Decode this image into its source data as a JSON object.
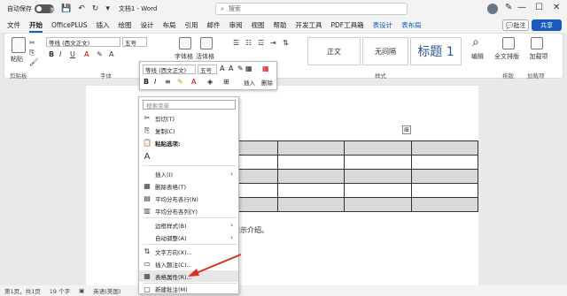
{
  "titlebar": {
    "autosave_label": "自动保存",
    "autosave_state": "关",
    "doc_title": "文档1 - Word",
    "search_placeholder": "搜索",
    "minimize": "—",
    "maximize": "☐",
    "close": "✕"
  },
  "menu": {
    "tabs": [
      "文件",
      "开始",
      "OfficePLUS",
      "插入",
      "绘图",
      "设计",
      "布局",
      "引用",
      "邮件",
      "审阅",
      "视图",
      "帮助",
      "开发工具",
      "PDF工具箱",
      "表设计",
      "表布局"
    ],
    "active_tab": "开始",
    "comment_label": "批注",
    "share_label": "共享"
  },
  "ribbon": {
    "paste_label": "粘贴",
    "clipboard_label": "剪贴板",
    "font_name": "等线 (西文正文)",
    "font_size": "五号",
    "font_group_label": "字体",
    "char_form_label": "字体格",
    "paste_style_label": "活体格",
    "styles": [
      "正文",
      "无间隔",
      "标题 1"
    ],
    "styles_group_label": "样式",
    "editing_label": "编辑",
    "fullscreen_label": "全文排版",
    "layout_group_label": "排版",
    "addin_label": "加载项",
    "addin_group_label": "加载项"
  },
  "mini_toolbar": {
    "font_name": "等线 (西文正文)",
    "font_size": "五号",
    "insert_label": "插入",
    "delete_label": "删除"
  },
  "context_menu": {
    "search_placeholder": "搜索菜单",
    "items": [
      {
        "icon": "✂",
        "label": "剪切(T)"
      },
      {
        "icon": "⎘",
        "label": "复制(C)"
      },
      {
        "icon": "📋",
        "label": "粘贴选项:"
      },
      {
        "icon": "A",
        "label": ""
      },
      {
        "icon": "",
        "label": "插入(I)",
        "submenu": true
      },
      {
        "icon": "▦",
        "label": "删除表格(T)"
      },
      {
        "icon": "▤",
        "label": "平均分布各行(N)"
      },
      {
        "icon": "▥",
        "label": "平均分布各列(Y)"
      },
      {
        "icon": "",
        "label": "边框样式(B)",
        "submenu": true
      },
      {
        "icon": "",
        "label": "自动调整(A)",
        "submenu": true
      },
      {
        "icon": "⇅",
        "label": "文字方向(X)..."
      },
      {
        "icon": "▭",
        "label": "插入题注(C)..."
      },
      {
        "icon": "▦",
        "label": "表格属性(R)..."
      },
      {
        "icon": "▢",
        "label": "新建批注(M)"
      }
    ]
  },
  "document": {
    "body_text": "演示介绍。"
  },
  "statusbar": {
    "page": "第1页，共1页",
    "words": "19 个字",
    "language": "英语(美国)"
  },
  "colors": {
    "accent": "#185abd",
    "arrow": "#d93025"
  }
}
